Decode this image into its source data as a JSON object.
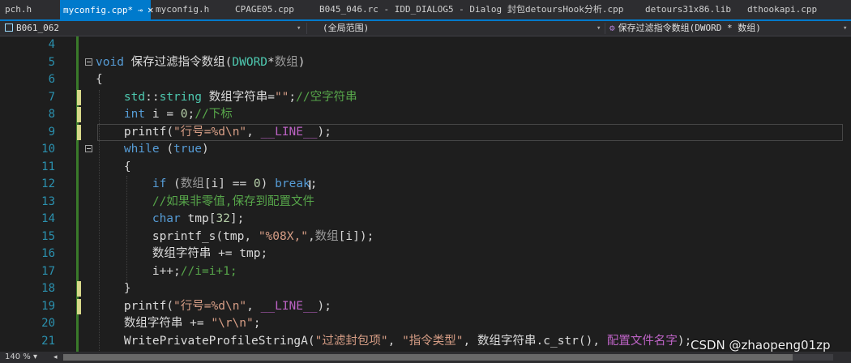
{
  "tabs": [
    {
      "label": "pch.h",
      "active": false
    },
    {
      "label": "myconfig.cpp*",
      "active": true
    },
    {
      "label": "myconfig.h",
      "active": false
    },
    {
      "label": "CPAGE05.cpp",
      "active": false
    },
    {
      "label": "B045_046.rc - IDD_DIALOG5 - Dialog",
      "active": false
    },
    {
      "label": "封包detoursHook分析.cpp",
      "active": false
    },
    {
      "label": "detours31x86.lib",
      "active": false
    },
    {
      "label": "dthookapi.cpp",
      "active": false
    }
  ],
  "nav": {
    "project": "B061_062",
    "scope": "(全局范围)",
    "member": "保存过滤指令数组(DWORD * 数组)"
  },
  "code_lines": [
    {
      "num": "4",
      "text": ""
    },
    {
      "num": "5",
      "text": "void 保存过滤指令数组(DWORD*数组)"
    },
    {
      "num": "6",
      "text": "{"
    },
    {
      "num": "7",
      "text": "std::string 数组字符串=\"\";//空字符串"
    },
    {
      "num": "8",
      "text": "int i = 0;//下标"
    },
    {
      "num": "9",
      "text": "printf(\"行号=%d\\n\", __LINE__);"
    },
    {
      "num": "10",
      "text": "while (true)"
    },
    {
      "num": "11",
      "text": "{"
    },
    {
      "num": "12",
      "text": "if (数组[i] == 0) break;"
    },
    {
      "num": "13",
      "text": "//如果非零值,保存到配置文件"
    },
    {
      "num": "14",
      "text": "char tmp[32];"
    },
    {
      "num": "15",
      "text": "sprintf_s(tmp, \"%08X,\",数组[i]);"
    },
    {
      "num": "16",
      "text": "数组字符串 += tmp;"
    },
    {
      "num": "17",
      "text": "i++;//i=i+1;"
    },
    {
      "num": "18",
      "text": "}"
    },
    {
      "num": "19",
      "text": "printf(\"行号=%d\\n\", __LINE__);"
    },
    {
      "num": "20",
      "text": "数组字符串 += \"\\r\\n\";"
    },
    {
      "num": "21",
      "text": "WritePrivateProfileStringA(\"过滤封包项\", \"指令类型\", 数组字符串.c_str(), 配置文件名字);"
    }
  ],
  "status": {
    "zoom": "140 %"
  },
  "watermark": "CSDN @zhaopeng01zp",
  "colors": {
    "accent": "#007acc",
    "keyword": "#569cd6",
    "string": "#d69d85",
    "comment": "#57a64a",
    "type": "#4ec9b0",
    "macro": "#bd63c5",
    "line_number": "#2b91af"
  }
}
